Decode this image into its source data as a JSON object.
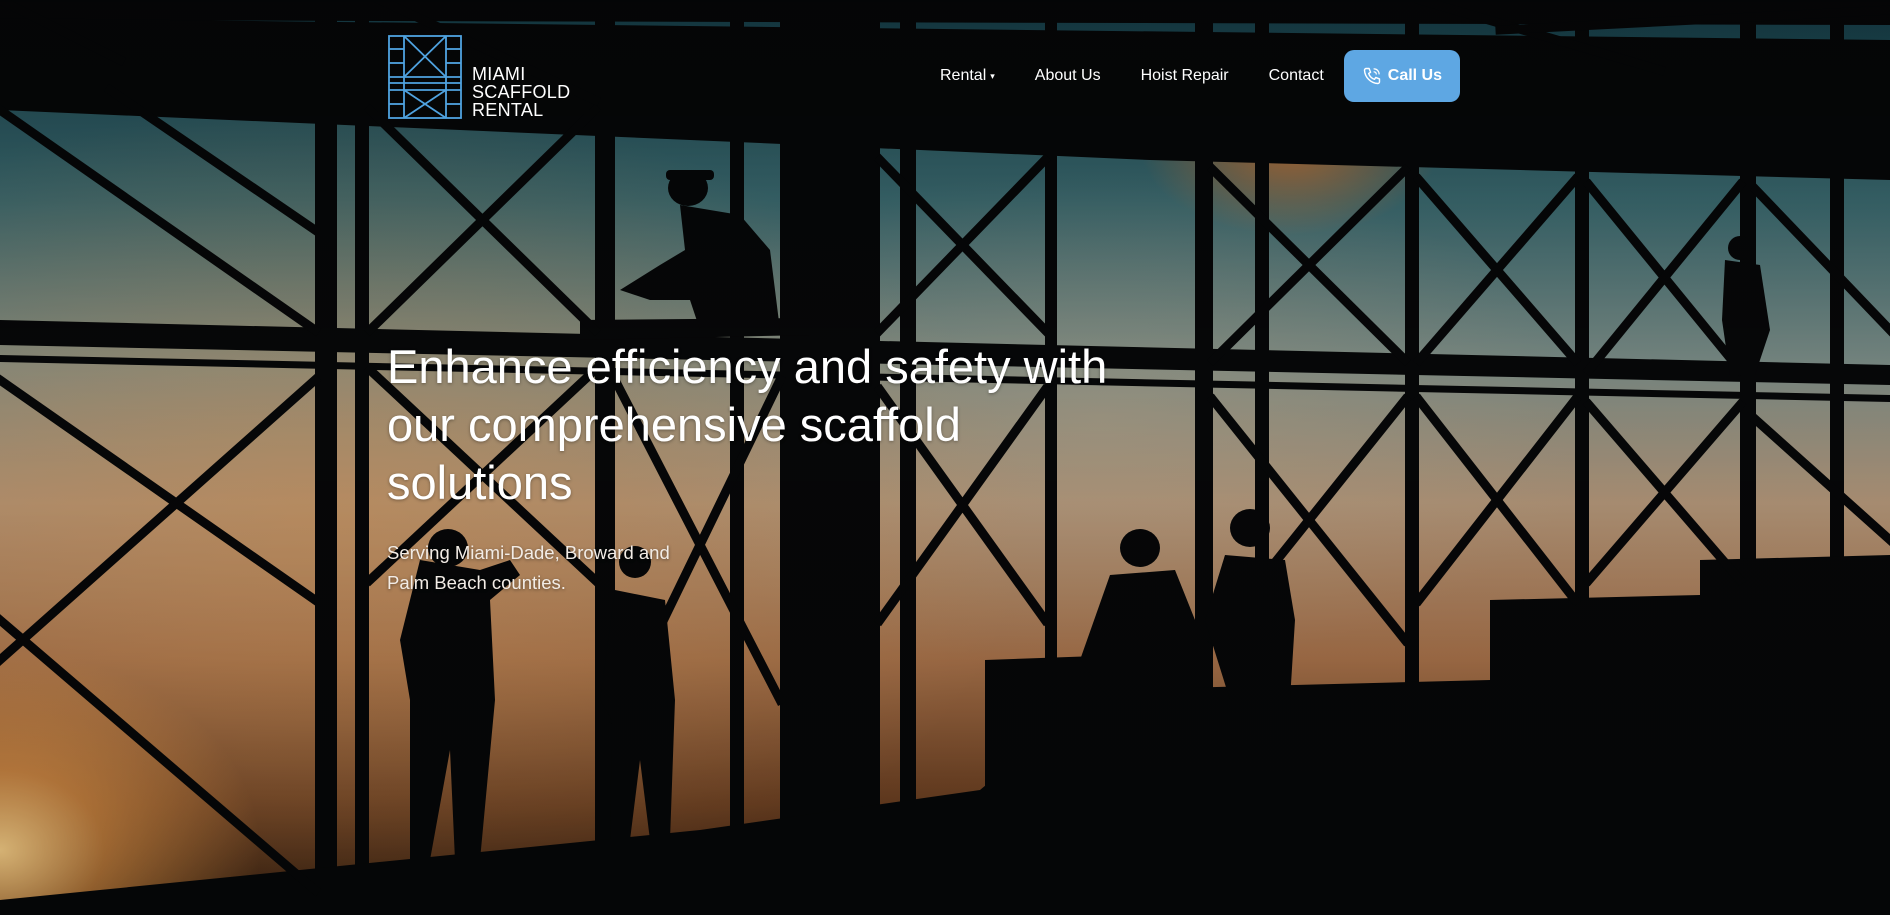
{
  "brand": {
    "lines": [
      "MIAMI",
      "SCAFFOLD",
      "RENTAL"
    ],
    "logo_icon": "scaffold-frame-icon",
    "logo_color": "#4fa3e0"
  },
  "nav": {
    "items": [
      {
        "label": "Rental",
        "has_dropdown": true
      },
      {
        "label": "About Us",
        "has_dropdown": false
      },
      {
        "label": "Hoist Repair",
        "has_dropdown": false
      },
      {
        "label": "Contact",
        "has_dropdown": false
      }
    ],
    "cta": {
      "label": "Call Us",
      "icon": "phone-icon",
      "color": "#5ea7e3"
    }
  },
  "hero": {
    "headline": "Enhance efficiency and safety with our comprehensive scaffold solutions",
    "subhead": "Serving Miami-Dade, Broward and Palm Beach counties.",
    "background": "construction-workers-silhouette-on-scaffolding-at-sunset"
  }
}
